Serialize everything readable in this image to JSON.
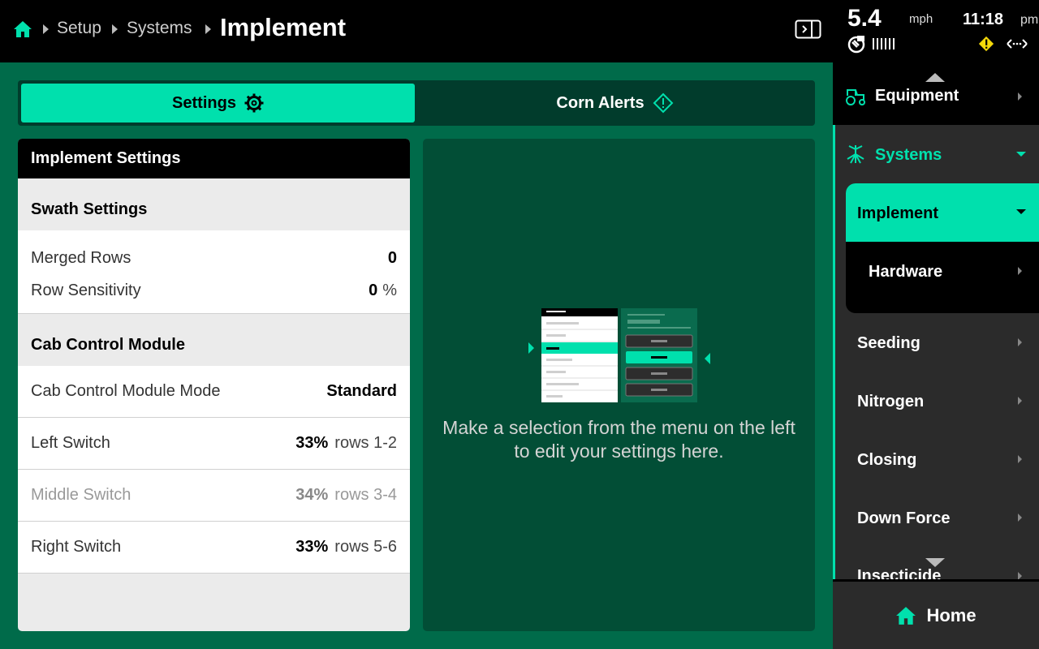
{
  "breadcrumb": {
    "items": [
      "Setup",
      "Systems"
    ],
    "current": "Implement"
  },
  "status": {
    "speed": "5.4",
    "speed_unit": "mph",
    "time": "11:18",
    "ampm": "pm"
  },
  "tabs": [
    {
      "label": "Settings",
      "icon": "gear-icon",
      "active": true
    },
    {
      "label": "Corn Alerts",
      "icon": "alert-diamond-icon",
      "active": false
    }
  ],
  "settings_card": {
    "header": "Implement Settings",
    "swath": {
      "title": "Swath Settings",
      "merged_rows_label": "Merged Rows",
      "merged_rows_value": "0",
      "row_sensitivity_label": "Row Sensitivity",
      "row_sensitivity_value": "0",
      "row_sensitivity_unit": "%"
    },
    "ccm": {
      "title": "Cab Control Module",
      "mode_label": "Cab Control Module Mode",
      "mode_value": "Standard",
      "switches": [
        {
          "label": "Left Switch",
          "pct": "33%",
          "rows": "rows 1-2",
          "enabled": true
        },
        {
          "label": "Middle Switch",
          "pct": "34%",
          "rows": "rows 3-4",
          "enabled": false
        },
        {
          "label": "Right Switch",
          "pct": "33%",
          "rows": "rows 5-6",
          "enabled": true
        }
      ]
    }
  },
  "placeholder": {
    "text": "Make a selection from the menu on the left to edit your settings here."
  },
  "nav": {
    "equipment": "Equipment",
    "systems": "Systems",
    "implement": "Implement",
    "hardware": "Hardware",
    "items": [
      "Seeding",
      "Nitrogen",
      "Closing",
      "Down Force",
      "Insecticide"
    ],
    "home": "Home"
  },
  "colors": {
    "accent": "#00e0ad",
    "main_bg": "#006b4a",
    "panel_bg": "#024e36",
    "tab_bar_bg": "#013c2c",
    "warning": "#f5d90a"
  }
}
